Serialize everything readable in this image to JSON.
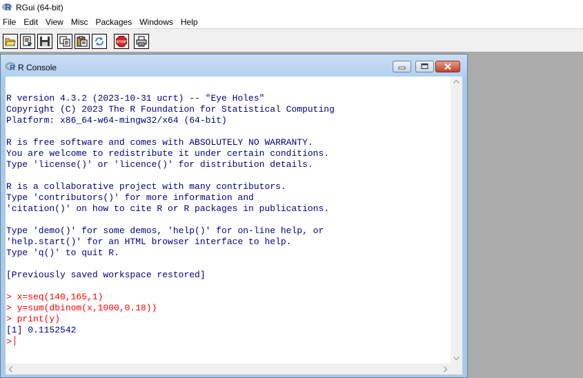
{
  "app": {
    "title": "RGui (64-bit)"
  },
  "menu": {
    "items": [
      "File",
      "Edit",
      "View",
      "Misc",
      "Packages",
      "Windows",
      "Help"
    ]
  },
  "toolbar": {
    "buttons": [
      {
        "icon": "open-script-icon"
      },
      {
        "icon": "load-workspace-icon"
      },
      {
        "icon": "save-workspace-icon"
      },
      {
        "icon": "copy-icon"
      },
      {
        "icon": "paste-icon"
      },
      {
        "icon": "copy-paste-icon"
      },
      {
        "icon": "stop-icon",
        "label": "STOP"
      },
      {
        "icon": "print-icon"
      }
    ]
  },
  "console": {
    "title": "R Console",
    "lines": [
      {
        "text": "R version 4.3.2 (2023-10-31 ucrt) -- \"Eye Holes\"",
        "kind": "output"
      },
      {
        "text": "Copyright (C) 2023 The R Foundation for Statistical Computing",
        "kind": "output"
      },
      {
        "text": "Platform: x86_64-w64-mingw32/x64 (64-bit)",
        "kind": "output"
      },
      {
        "text": "",
        "kind": "output"
      },
      {
        "text": "R is free software and comes with ABSOLUTELY NO WARRANTY.",
        "kind": "output"
      },
      {
        "text": "You are welcome to redistribute it under certain conditions.",
        "kind": "output"
      },
      {
        "text": "Type 'license()' or 'licence()' for distribution details.",
        "kind": "output"
      },
      {
        "text": "",
        "kind": "output"
      },
      {
        "text": "R is a collaborative project with many contributors.",
        "kind": "output"
      },
      {
        "text": "Type 'contributors()' for more information and",
        "kind": "output"
      },
      {
        "text": "'citation()' on how to cite R or R packages in publications.",
        "kind": "output"
      },
      {
        "text": "",
        "kind": "output"
      },
      {
        "text": "Type 'demo()' for some demos, 'help()' for on-line help, or",
        "kind": "output"
      },
      {
        "text": "'help.start()' for an HTML browser interface to help.",
        "kind": "output"
      },
      {
        "text": "Type 'q()' to quit R.",
        "kind": "output"
      },
      {
        "text": "",
        "kind": "output"
      },
      {
        "text": "[Previously saved workspace restored]",
        "kind": "output"
      },
      {
        "text": "",
        "kind": "output"
      },
      {
        "text": "> x=seq(140,165,1)",
        "kind": "input"
      },
      {
        "text": "> y=sum(dbinom(x,1000,0.18))",
        "kind": "input"
      },
      {
        "text": "> print(y)",
        "kind": "input"
      },
      {
        "text": "[1] 0.1152542",
        "kind": "output"
      }
    ],
    "prompt": ">",
    "colors": {
      "output": "#000080",
      "input": "#ff0000",
      "background": "#ffffff"
    }
  }
}
